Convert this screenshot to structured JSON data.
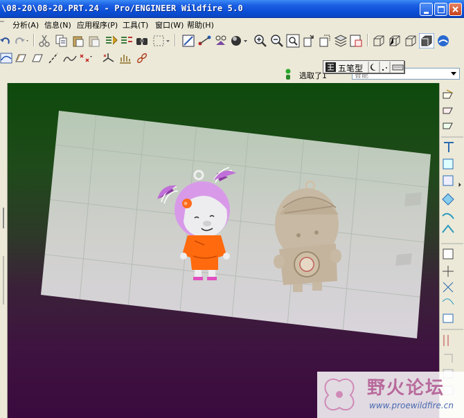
{
  "window": {
    "title": "\\08-20\\08-20.PRT.24 - Pro/ENGINEER Wildfire 5.0"
  },
  "menu": {
    "items": [
      {
        "label": "分析(A)"
      },
      {
        "label": "信息(N)"
      },
      {
        "label": "应用程序(P)"
      },
      {
        "label": "工具(T)"
      },
      {
        "label": "窗口(W)"
      },
      {
        "label": "帮助(H)"
      }
    ]
  },
  "status": {
    "filter_label": "选取了1",
    "filter_value": "智能"
  },
  "ime": {
    "mode": "五笔型"
  },
  "watermark": {
    "text": "野火论坛",
    "url": "www.proewildfire.cn"
  },
  "colors": {
    "titlebar": "#0a4ed6",
    "viewport_top": "#0e4a0c",
    "viewport_bottom": "#3a0a3e",
    "character_dress": "#ff6a0e",
    "character_head": "#d89ae8"
  }
}
